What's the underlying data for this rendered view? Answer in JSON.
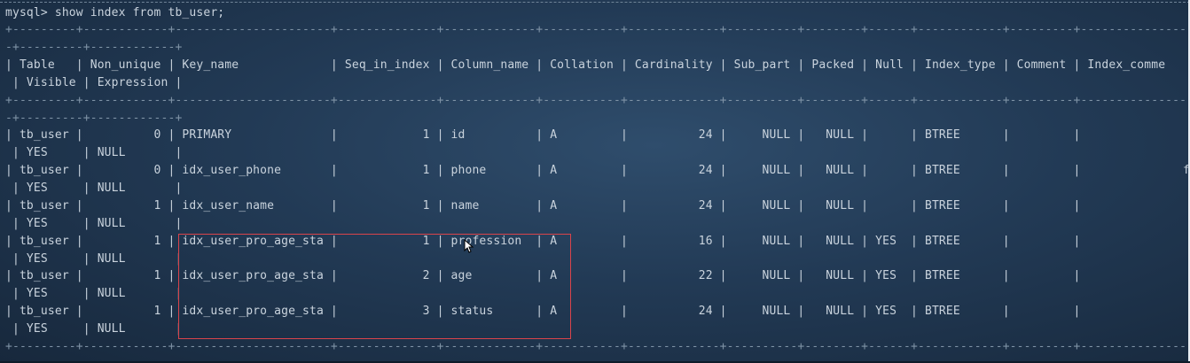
{
  "terminal": {
    "lines": [
      "mysql> show index from tb_user;",
      "+---------+------------+----------------------+--------------+-------------+-----------+-------------+----------+--------+------+------------+---------+---------------",
      "-+---------+------------+",
      "| Table   | Non_unique | Key_name             | Seq_in_index | Column_name | Collation | Cardinality | Sub_part | Packed | Null | Index_type | Comment | Index_comme",
      " | Visible | Expression |",
      "+---------+------------+----------------------+--------------+-------------+-----------+-------------+----------+--------+------+------------+---------+---------------",
      "-+---------+------------+",
      "| tb_user |          0 | PRIMARY              |            1 | id          | A         |          24 |     NULL |   NULL |      | BTREE      |         |",
      " | YES     | NULL       |",
      "| tb_user |          0 | idx_user_phone       |            1 | phone       | A         |          24 |     NULL |   NULL |      | BTREE      |         |",
      " | YES     | NULL       |",
      "| tb_user |          1 | idx_user_name        |            1 | name        | A         |          24 |     NULL |   NULL |      | BTREE      |         |",
      " | YES     | NULL       |",
      "| tb_user |          1 | idx_user_pro_age_sta |            1 | profession  | A         |          16 |     NULL |   NULL | YES  | BTREE      |         |",
      " | YES     | NULL       |",
      "| tb_user |          1 | idx_user_pro_age_sta |            2 | age         | A         |          22 |     NULL |   NULL | YES  | BTREE      |         |",
      " | YES     | NULL       |",
      "| tb_user |          1 | idx_user_pro_age_sta |            3 | status      | A         |          24 |     NULL |   NULL | YES  | BTREE      |         |",
      " | YES     | NULL       |",
      "+---------+------------+----------------------+--------------+-------------+-----------+-------------+----------+--------+------+------------+---------+---------------"
    ],
    "stray_char": "f"
  },
  "colors": {
    "highlight_border": "#d9444b",
    "text": "#c9d3dd"
  }
}
